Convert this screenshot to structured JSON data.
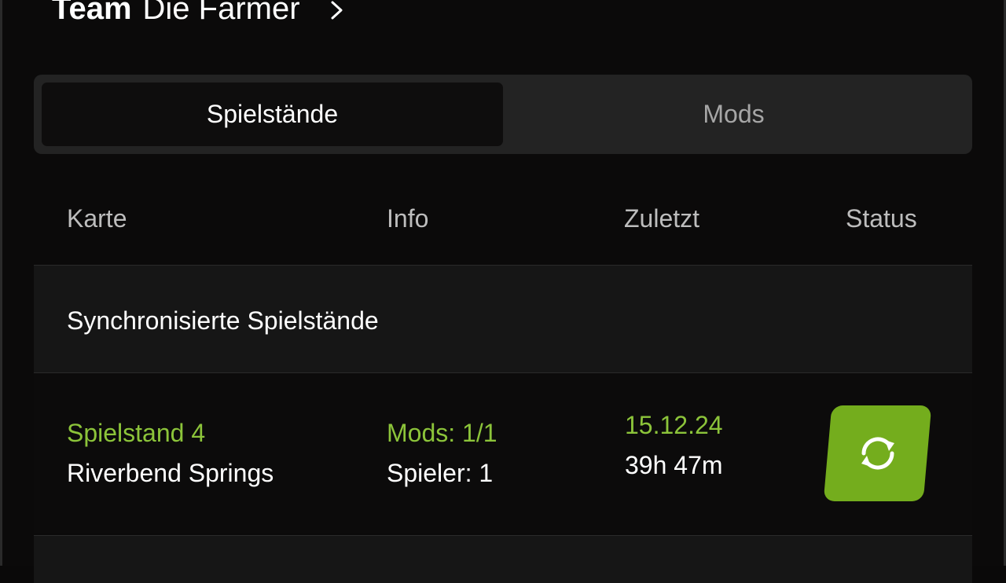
{
  "header": {
    "team_prefix": "Team",
    "team_name": "Die Farmer",
    "chevron_icon": "chevron-right-icon"
  },
  "tabs": [
    {
      "label": "Spielstände",
      "active": true
    },
    {
      "label": "Mods",
      "active": false
    }
  ],
  "table": {
    "columns": [
      "Karte",
      "Info",
      "Zuletzt",
      "Status"
    ],
    "section_label": "Synchronisierte Spielstände",
    "rows": [
      {
        "save_name": "Spielstand 4",
        "map_name": "Riverbend Springs",
        "mods": "Mods: 1/1",
        "players": "Spieler: 1",
        "date": "15.12.24",
        "playtime": "39h 47m",
        "status_icon": "sync-icon"
      }
    ]
  },
  "colors": {
    "accent_green": "#8cc43a",
    "button_green": "#74ad1d",
    "background": "#0b0a0a",
    "panel": "#232323"
  }
}
